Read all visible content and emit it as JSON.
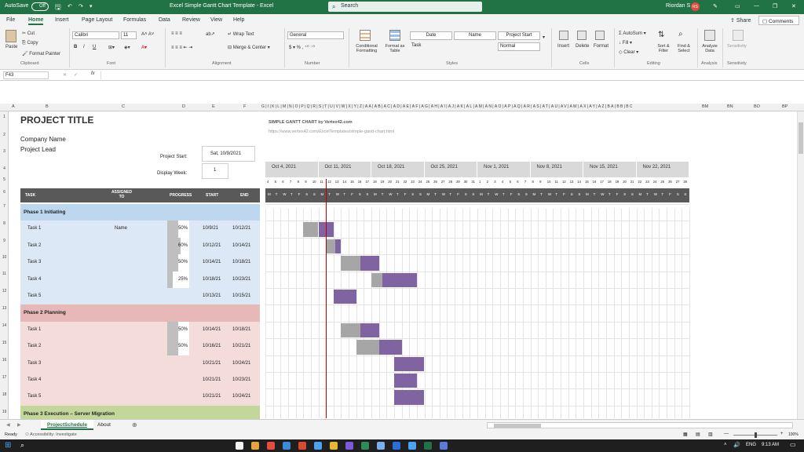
{
  "titlebar": {
    "autosave": "AutoSave",
    "autosave_state": "Off",
    "file_title": "Excel Simple Gantt Chart Template - Excel",
    "search": "Search",
    "user": "Riordan S",
    "user_initials": "RS"
  },
  "menu": {
    "tabs": [
      "File",
      "Home",
      "Insert",
      "Page Layout",
      "Formulas",
      "Data",
      "Review",
      "View",
      "Help"
    ],
    "share": "Share",
    "comments": "Comments"
  },
  "ribbon": {
    "paste": "Paste",
    "cut": "Cut",
    "copy": "Copy",
    "format_painter": "Format Painter",
    "clipboard": "Clipboard",
    "font_name": "Calibri",
    "font_size": "11",
    "font": "Font",
    "wrap_text": "Wrap Text",
    "merge_center": "Merge & Center",
    "alignment": "Alignment",
    "number_format": "General",
    "number": "Number",
    "conditional_formatting": "Conditional Formatting",
    "format_as_table": "Format as Table",
    "style_date": "Date",
    "style_name": "Name",
    "style_project_start": "Project Start",
    "style_normal": "Normal",
    "style_task": "Task",
    "styles": "Styles",
    "insert": "Insert",
    "delete": "Delete",
    "format": "Format",
    "cells": "Cells",
    "autosum": "AutoSum",
    "fill": "Fill",
    "clear": "Clear",
    "sort_filter": "Sort & Filter",
    "find_select": "Find & Select",
    "editing": "Editing",
    "analyze_data": "Analyze Data",
    "analysis": "Analysis",
    "sensitivity": "Sensitivity"
  },
  "formula_bar": {
    "name_box": "F43",
    "fx": "fx",
    "value": ""
  },
  "sheet": {
    "project_title": "PROJECT TITLE",
    "company": "Company Name",
    "lead": "Project Lead",
    "project_start_label": "Project Start:",
    "project_start_value": "Sat, 10/9/2021",
    "display_week_label": "Display Week:",
    "display_week_value": "1",
    "gantt_title": "SIMPLE GANTT CHART by Vertex42.com",
    "gantt_url": "https://www.vertex42.com/ExcelTemplates/simple-gantt-chart.html",
    "headers": {
      "task": "TASK",
      "assigned": "ASSIGNED TO",
      "progress": "PROGRESS",
      "start": "START",
      "end": "END"
    },
    "weeks": [
      "Oct 4, 2021",
      "Oct 11, 2021",
      "Oct 18, 2021",
      "Oct 25, 2021",
      "Nov 1, 2021",
      "Nov 8, 2021",
      "Nov 15, 2021",
      "Nov 22, 2021"
    ],
    "day_numbers": [
      "4",
      "5",
      "6",
      "7",
      "8",
      "9",
      "10",
      "11",
      "12",
      "13",
      "14",
      "15",
      "16",
      "17",
      "18",
      "19",
      "20",
      "21",
      "22",
      "23",
      "24",
      "25",
      "26",
      "27",
      "28",
      "29",
      "30",
      "31",
      "1",
      "2",
      "3",
      "4",
      "5",
      "6",
      "7",
      "8",
      "9",
      "10",
      "11",
      "12",
      "13",
      "14",
      "15",
      "16",
      "17",
      "18",
      "19",
      "20",
      "21",
      "22",
      "23",
      "24",
      "25",
      "26",
      "27",
      "28"
    ],
    "day_letters": "MTWTFSS",
    "phases": [
      {
        "name": "Phase 1 Initiating",
        "color": "#bdd7ee",
        "row_color": "#dce8f5",
        "tasks": [
          {
            "name": "Task 1",
            "assigned": "Name",
            "progress": 50,
            "progress_label": "50%",
            "start": "10/9/21",
            "end": "10/12/21",
            "bar_start_day": 5,
            "bar_days": 4
          },
          {
            "name": "Task 2",
            "assigned": "",
            "progress": 60,
            "progress_label": "60%",
            "start": "10/12/21",
            "end": "10/14/21",
            "bar_start_day": 8,
            "bar_days": 2
          },
          {
            "name": "Task 3",
            "assigned": "",
            "progress": 50,
            "progress_label": "50%",
            "start": "10/14/21",
            "end": "10/18/21",
            "bar_start_day": 10,
            "bar_days": 5
          },
          {
            "name": "Task 4",
            "assigned": "",
            "progress": 25,
            "progress_label": "25%",
            "start": "10/18/21",
            "end": "10/23/21",
            "bar_start_day": 14,
            "bar_days": 6
          },
          {
            "name": "Task 5",
            "assigned": "",
            "progress": 0,
            "progress_label": "",
            "start": "10/13/21",
            "end": "10/15/21",
            "bar_start_day": 9,
            "bar_days": 3
          }
        ]
      },
      {
        "name": "Phase 2 Planning",
        "color": "#e6b8b7",
        "row_color": "#f4dcdb",
        "tasks": [
          {
            "name": "Task 1",
            "assigned": "",
            "progress": 50,
            "progress_label": "50%",
            "start": "10/14/21",
            "end": "10/18/21",
            "bar_start_day": 10,
            "bar_days": 5
          },
          {
            "name": "Task 2",
            "assigned": "",
            "progress": 50,
            "progress_label": "50%",
            "start": "10/16/21",
            "end": "10/21/21",
            "bar_start_day": 12,
            "bar_days": 6
          },
          {
            "name": "Task 3",
            "assigned": "",
            "progress": 0,
            "progress_label": "",
            "start": "10/21/21",
            "end": "10/24/21",
            "bar_start_day": 17,
            "bar_days": 4
          },
          {
            "name": "Task 4",
            "assigned": "",
            "progress": 0,
            "progress_label": "",
            "start": "10/21/21",
            "end": "10/23/21",
            "bar_start_day": 17,
            "bar_days": 3
          },
          {
            "name": "Task 5",
            "assigned": "",
            "progress": 0,
            "progress_label": "",
            "start": "10/21/21",
            "end": "10/24/21",
            "bar_start_day": 17,
            "bar_days": 4
          }
        ]
      },
      {
        "name": "Phase 3 Execution – Server Migration",
        "color": "#c4d79b",
        "row_color": "#e2ecce",
        "tasks": []
      }
    ],
    "today_day": 8
  },
  "sheet_tabs": {
    "active": "ProjectSchedule",
    "other": "About"
  },
  "status": {
    "ready": "Ready",
    "accessibility": "Accessibility: Investigate",
    "zoom": "100%"
  },
  "taskbar": {
    "lang": "ENG",
    "time": "9:13 AM"
  },
  "colors": {
    "excel_green": "#217346",
    "bar_purple": "#8064a2",
    "bar_gray": "#a6a6a6",
    "today_line": "#c00000"
  }
}
